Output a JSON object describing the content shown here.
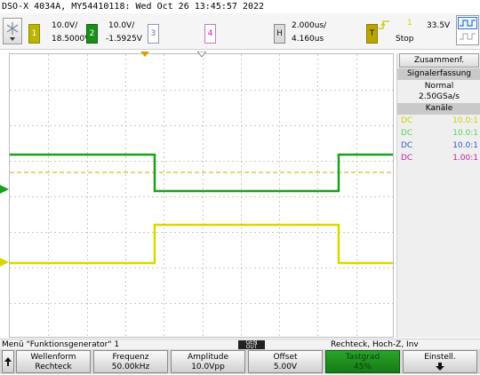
{
  "title": "DSO-X 4034A, MY54410118: Wed Oct 26 13:45:57 2022",
  "channels": [
    {
      "id": "1",
      "scale": "10.0V/",
      "offset": "18.5000V",
      "color": "#c8c800"
    },
    {
      "id": "2",
      "scale": "10.0V/",
      "offset": "-1.5925V",
      "color": "#1a9a1a"
    },
    {
      "id": "3",
      "color": "#5b6fb0"
    },
    {
      "id": "4",
      "color": "#c01fa0"
    }
  ],
  "timebase": {
    "label": "H",
    "scale": "2.000us/",
    "delay": "4.160us"
  },
  "trigger": {
    "label": "T",
    "level": "33.5V",
    "status": "Stop",
    "source_marker": "1"
  },
  "panel": {
    "zoom_button": "Zusammenf.",
    "acq_header": "Signalerfassung",
    "acq_mode": "Normal",
    "sample_rate": "2.50GSa/s",
    "channels_header": "Kanäle",
    "channel_rows": [
      {
        "coupling": "DC",
        "probe": "10.0:1",
        "color": "#d0d000"
      },
      {
        "coupling": "DC",
        "probe": "10.0:1",
        "color": "#5cd05c"
      },
      {
        "coupling": "DC",
        "probe": "10.0:1",
        "color": "#3a56c8"
      },
      {
        "coupling": "DC",
        "probe": "1.00:1",
        "color": "#c01fa0"
      }
    ]
  },
  "menu": {
    "title": "Menü \"Funktionsgenerator\" 1",
    "gen_badge": "GEN",
    "gen_sub": "OUT",
    "summary": "Rechteck, Hoch-Z, Inv"
  },
  "softkeys": [
    {
      "label": "Wellenform",
      "value": "Rechteck"
    },
    {
      "label": "Frequenz",
      "value": "50.00kHz"
    },
    {
      "label": "Amplitude",
      "value": "10.0Vpp"
    },
    {
      "label": "Offset",
      "value": "5.00V"
    },
    {
      "label": "Tastgrad",
      "value": "45%"
    },
    {
      "label": "Einstell.",
      "value": ""
    }
  ],
  "colors": {
    "ch1": "#d8d800",
    "ch2": "#1aa01a",
    "trigger_level": "#d8a000",
    "grid": "#c8c8c8",
    "active_key": "#1f8a1f"
  }
}
